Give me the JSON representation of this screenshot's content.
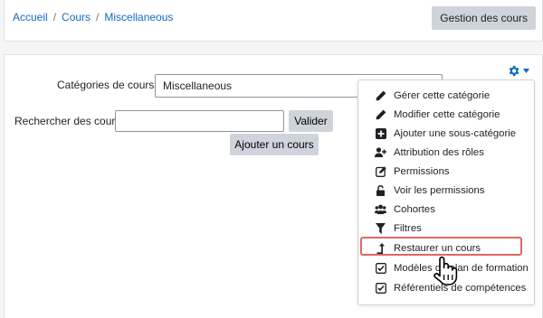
{
  "breadcrumb": [
    {
      "label": "Accueil"
    },
    {
      "label": "Cours"
    },
    {
      "label": "Miscellaneous"
    }
  ],
  "breadcrumb_separator": "/",
  "header": {
    "manage_button": "Gestion des cours"
  },
  "form": {
    "category_label": "Catégories de cours:",
    "category_value": "Miscellaneous",
    "search_label": "Rechercher des cours",
    "search_value": "",
    "search_button": "Valider",
    "add_course_button": "Ajouter un cours"
  },
  "menu": {
    "items": [
      {
        "label": "Gérer cette catégorie",
        "icon": "pencil-icon"
      },
      {
        "label": "Modifier cette catégorie",
        "icon": "pencil-icon"
      },
      {
        "label": "Ajouter une sous-catégorie",
        "icon": "plus-square-icon"
      },
      {
        "label": "Attribution des rôles",
        "icon": "user-plus-icon"
      },
      {
        "label": "Permissions",
        "icon": "edit-square-icon"
      },
      {
        "label": "Voir les permissions",
        "icon": "unlock-icon"
      },
      {
        "label": "Cohortes",
        "icon": "users-icon"
      },
      {
        "label": "Filtres",
        "icon": "filter-icon"
      },
      {
        "label": "Restaurer un cours",
        "icon": "level-up-icon",
        "highlighted": true
      },
      {
        "label": "Modèles de plan de formation",
        "icon": "check-square-icon"
      },
      {
        "label": "Référentiels de compétences",
        "icon": "check-square-icon"
      }
    ]
  },
  "colors": {
    "link": "#0f6cbf",
    "highlight_border": "#e06666",
    "button_bg": "#ced4da"
  }
}
